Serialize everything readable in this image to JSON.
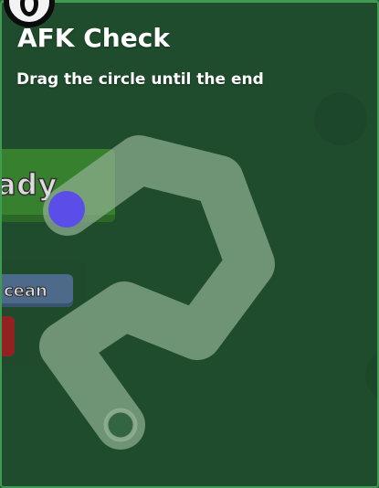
{
  "overlay": {
    "title": "AFK Check",
    "instruction": "Drag the circle until the end"
  },
  "background_ui": {
    "ready_label": "ady",
    "region_label": "cean"
  },
  "drag_task": {
    "progress": 0,
    "handle_color": "#5b4de8",
    "path_color": "#8fae92",
    "end_marker_color": "#8fae92"
  },
  "colors": {
    "overlay_background": "#255534",
    "frame_border": "#3f9a52",
    "ready_panel": "#3c8a2e",
    "region_badge": "#4d6a8a",
    "alert_badge": "#922222"
  }
}
